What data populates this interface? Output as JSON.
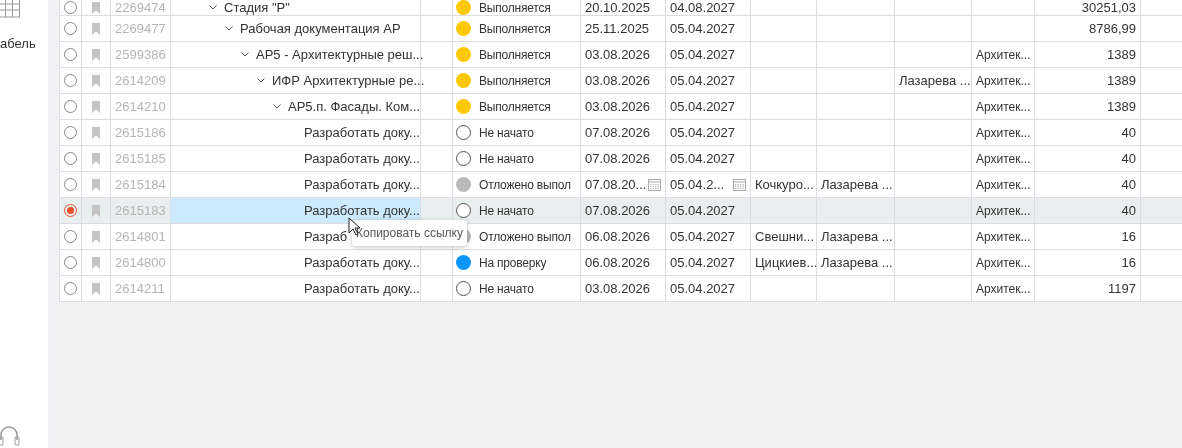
{
  "sidebar": {
    "label": "абель"
  },
  "rows": [
    {
      "id": "2269474",
      "name": "Стадия \"Р\"",
      "expanded": true,
      "selected": false,
      "status": {
        "kind": "in_progress",
        "label": "Выполняется"
      },
      "start": "20.10.2025",
      "end": "04.08.2027",
      "amount": "30251,03",
      "children": [
        {
          "id": "2269477",
          "name": "Рабочая документация АР",
          "expanded": true,
          "selected": false,
          "status": {
            "kind": "in_progress",
            "label": "Выполняется"
          },
          "start": "25.11.2025",
          "end": "05.04.2027",
          "amount": "8786,99",
          "children": [
            {
              "id": "2599386",
              "name": "АР5 - Архитектурные реш...",
              "expanded": true,
              "selected": false,
              "status": {
                "kind": "in_progress",
                "label": "Выполняется"
              },
              "start": "03.08.2026",
              "end": "05.04.2027",
              "category": "Архитек...",
              "amount": "1389",
              "children": [
                {
                  "id": "2614209",
                  "name": "ИФР Архитектурные ре...",
                  "expanded": true,
                  "selected": false,
                  "status": {
                    "kind": "in_progress",
                    "label": "Выполняется"
                  },
                  "start": "03.08.2026",
                  "end": "05.04.2027",
                  "column_9": "Лазарева ...",
                  "category": "Архитек...",
                  "amount": "1389",
                  "children": [
                    {
                      "id": "2614210",
                      "name": "АР5.п. Фасады. Ком...",
                      "expanded": true,
                      "selected": false,
                      "status": {
                        "kind": "in_progress",
                        "label": "Выполняется"
                      },
                      "start": "03.08.2026",
                      "end": "05.04.2027",
                      "category": "Архитек...",
                      "amount": "1389",
                      "children": [
                        {
                          "id": "2615186",
                          "name": "Разработать доку...",
                          "selected": false,
                          "status": {
                            "kind": "not_started",
                            "label": "Не начато"
                          },
                          "start": "07.08.2026",
                          "end": "05.04.2027",
                          "category": "Архитек...",
                          "amount": "40"
                        },
                        {
                          "id": "2615185",
                          "name": "Разработать доку...",
                          "selected": false,
                          "status": {
                            "kind": "not_started",
                            "label": "Не начато"
                          },
                          "start": "07.08.2026",
                          "end": "05.04.2027",
                          "category": "Архитек...",
                          "amount": "40"
                        },
                        {
                          "id": "2615184",
                          "name": "Разработать доку...",
                          "selected": false,
                          "editing": true,
                          "status": {
                            "kind": "postponed",
                            "label": "Отложено выпол"
                          },
                          "start": "07.08.20...",
                          "end": "05.04.2...",
                          "person_1": "Кочкуро...",
                          "person_2": "Лазарева ...",
                          "category": "Архитек...",
                          "amount": "40"
                        },
                        {
                          "id": "2615183",
                          "name": "Разработать доку...",
                          "selected": true,
                          "tooltip": "Копировать ссылку",
                          "status": {
                            "kind": "not_started",
                            "label": "Не начато"
                          },
                          "start": "07.08.2026",
                          "end": "05.04.2027",
                          "category": "Архитек...",
                          "amount": "40"
                        },
                        {
                          "id": "2614801",
                          "name": "Разраб",
                          "selected": false,
                          "status": {
                            "kind": "postponed",
                            "label": "Отложено выпол"
                          },
                          "start": "06.08.2026",
                          "end": "05.04.2027",
                          "person_1": "Свешни...",
                          "person_2": "Лазарева ...",
                          "category": "Архитек...",
                          "amount": "16"
                        },
                        {
                          "id": "2614800",
                          "name": "Разработать доку...",
                          "selected": false,
                          "status": {
                            "kind": "review",
                            "label": "На проверку"
                          },
                          "start": "06.08.2026",
                          "end": "05.04.2027",
                          "person_1": "Цицкиев...",
                          "person_2": "Лазарева ...",
                          "category": "Архитек...",
                          "amount": "16"
                        },
                        {
                          "id": "2614211",
                          "name": "Разработать доку...",
                          "selected": false,
                          "status": {
                            "kind": "not_started",
                            "label": "Не начато"
                          },
                          "start": "03.08.2026",
                          "end": "05.04.2027",
                          "category": "Архитек...",
                          "amount": "1197"
                        }
                      ]
                    }
                  ]
                }
              ]
            }
          ]
        }
      ]
    }
  ]
}
